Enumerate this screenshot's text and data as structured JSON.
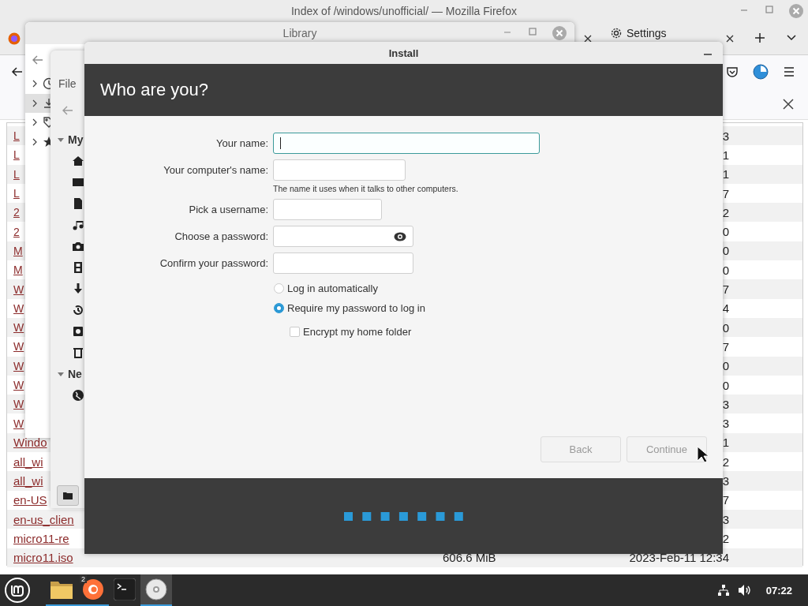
{
  "firefox": {
    "title": "Index of /windows/unofficial/ — Mozilla Firefox",
    "tab_label": "Settings",
    "listing": [
      {
        "name": "L",
        "date": "3"
      },
      {
        "name": "L",
        "date": "1"
      },
      {
        "name": "L",
        "date": "1"
      },
      {
        "name": "L",
        "date": "7"
      },
      {
        "name": "2",
        "date": "2"
      },
      {
        "name": "2",
        "date": "0"
      },
      {
        "name": "M",
        "date": "0"
      },
      {
        "name": "M",
        "date": "0"
      },
      {
        "name": "W",
        "date": "7"
      },
      {
        "name": "W",
        "date": "4"
      },
      {
        "name": "W",
        "date": "0"
      },
      {
        "name": "W",
        "date": "7"
      },
      {
        "name": "W",
        "date": "0"
      },
      {
        "name": "W",
        "date": "0"
      },
      {
        "name": "W",
        "date": "3"
      },
      {
        "name": "W",
        "date": "3"
      },
      {
        "name": "Windo",
        "date": "1"
      },
      {
        "name": "all_wi",
        "date": "2"
      },
      {
        "name": "all_wi",
        "date": "3"
      },
      {
        "name": "en-US",
        "date": "7"
      },
      {
        "name": "en-us_clien",
        "date": "3"
      },
      {
        "name": "micro11-re",
        "date": "2"
      },
      {
        "name": "micro11.iso",
        "size": "606.6 MiB",
        "date": "2023-Feb-11 12:34"
      }
    ]
  },
  "library": {
    "title": "Library",
    "items": [
      {
        "selected": false
      },
      {
        "selected": true
      },
      {
        "selected": false
      },
      {
        "selected": false
      }
    ]
  },
  "file_manager": {
    "menu": "File",
    "sections": [
      "My",
      "Ne"
    ]
  },
  "installer": {
    "title": "Install",
    "heading": "Who are you?",
    "fields": [
      {
        "label": "Your name:",
        "focused": true,
        "reveal": false
      },
      {
        "label": "Your computer's name:",
        "focused": false,
        "reveal": false,
        "hint": "The name it uses when it talks to other computers."
      },
      {
        "label": "Pick a username:",
        "focused": false,
        "reveal": false
      },
      {
        "label": "Choose a password:",
        "focused": false,
        "reveal": true
      },
      {
        "label": "Confirm your password:",
        "focused": false,
        "reveal": false
      }
    ],
    "options": [
      {
        "kind": "radio",
        "label": "Log in automatically",
        "selected": false
      },
      {
        "kind": "radio",
        "label": "Require my password to log in",
        "selected": true,
        "children": [
          {
            "kind": "checkbox",
            "label": "Encrypt my home folder",
            "checked": false
          }
        ]
      }
    ],
    "buttons": [
      {
        "label": "Back",
        "disabled": true
      },
      {
        "label": "Continue",
        "disabled": true
      }
    ]
  },
  "taskbar": {
    "apps": [
      {
        "kind": "folder",
        "running": true,
        "selected": false
      },
      {
        "kind": "firefox",
        "running": true,
        "selected": false,
        "badge": "2"
      },
      {
        "kind": "terminal",
        "running": false,
        "selected": false
      },
      {
        "kind": "disc",
        "running": true,
        "selected": true
      }
    ],
    "clock": "07:22"
  }
}
